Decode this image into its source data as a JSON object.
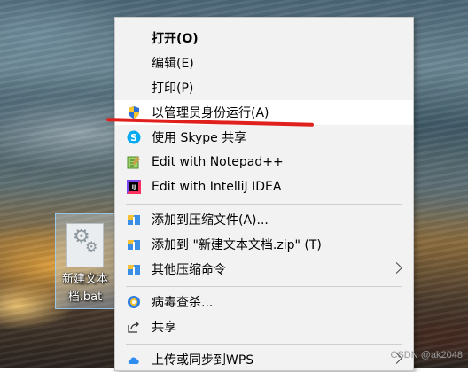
{
  "desktop_file": {
    "label_line1": "新建文本",
    "label_line2": "档.bat"
  },
  "context_menu": {
    "items": [
      {
        "label": "打开(O)",
        "icon": "none",
        "bold": true
      },
      {
        "label": "编辑(E)",
        "icon": "none"
      },
      {
        "label": "打印(P)",
        "icon": "none"
      },
      {
        "label": "以管理员身份运行(A)",
        "icon": "uac-shield-icon",
        "highlighted": true
      },
      {
        "label": "使用 Skype 共享",
        "icon": "skype-icon"
      },
      {
        "label": "Edit with Notepad++",
        "icon": "notepad-plus-plus-icon"
      },
      {
        "label": "Edit with IntelliJ IDEA",
        "icon": "intellij-idea-icon"
      },
      {
        "label": "添加到压缩文件(A)...",
        "icon": "archive-icon"
      },
      {
        "label": "添加到 \"新建文本文档.zip\" (T)",
        "icon": "archive-icon"
      },
      {
        "label": "其他压缩命令",
        "icon": "archive-icon",
        "submenu": true
      },
      {
        "label": "病毒查杀...",
        "icon": "antivirus-icon"
      },
      {
        "label": "共享",
        "icon": "share-icon"
      },
      {
        "label": "上传或同步到WPS",
        "icon": "wps-cloud-icon",
        "submenu": true
      }
    ]
  },
  "annotation": {
    "color": "#e0201c"
  },
  "watermark": "CSDN @ak2048"
}
